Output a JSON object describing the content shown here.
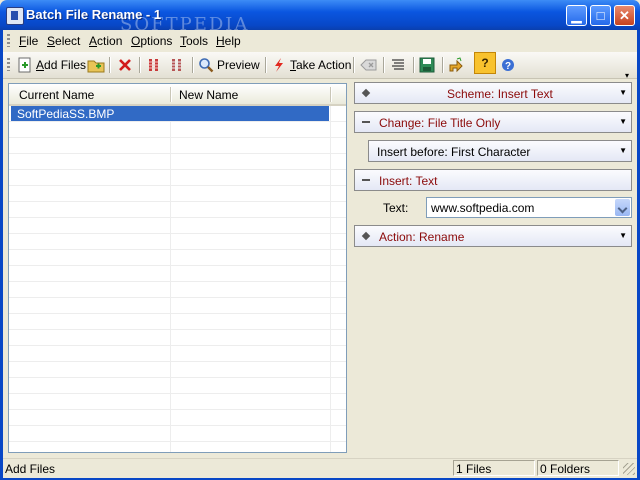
{
  "window": {
    "title": "Batch File Rename - 1",
    "watermark": "SOFTPEDIA"
  },
  "menu": [
    {
      "accel": "F",
      "rest": "ile"
    },
    {
      "accel": "S",
      "rest": "elect"
    },
    {
      "accel": "A",
      "rest": "ction"
    },
    {
      "accel": "O",
      "rest": "ptions"
    },
    {
      "accel": "T",
      "rest": "ools"
    },
    {
      "accel": "H",
      "rest": "elp"
    }
  ],
  "toolbar": {
    "add_files": {
      "accel": "A",
      "rest": "dd Files"
    },
    "preview": {
      "accel": "",
      "rest": "Preview"
    },
    "take_action": {
      "accel": "T",
      "rest": "ake Action"
    },
    "help": "?"
  },
  "filelist": {
    "columns": [
      "Current Name",
      "New Name"
    ],
    "rows": [
      {
        "current": "SoftPediaSS.BMP",
        "new": ""
      }
    ]
  },
  "panel": {
    "scheme": "Scheme: Insert Text",
    "change": "Change: File Title Only",
    "insert_before": "Insert before: First Character",
    "insert": "Insert: Text",
    "text_label": "Text:",
    "text_value": "www.softpedia.com",
    "action": "Action: Rename"
  },
  "status": {
    "message": "Add Files",
    "files": "1 Files",
    "folders": "0 Folders"
  }
}
